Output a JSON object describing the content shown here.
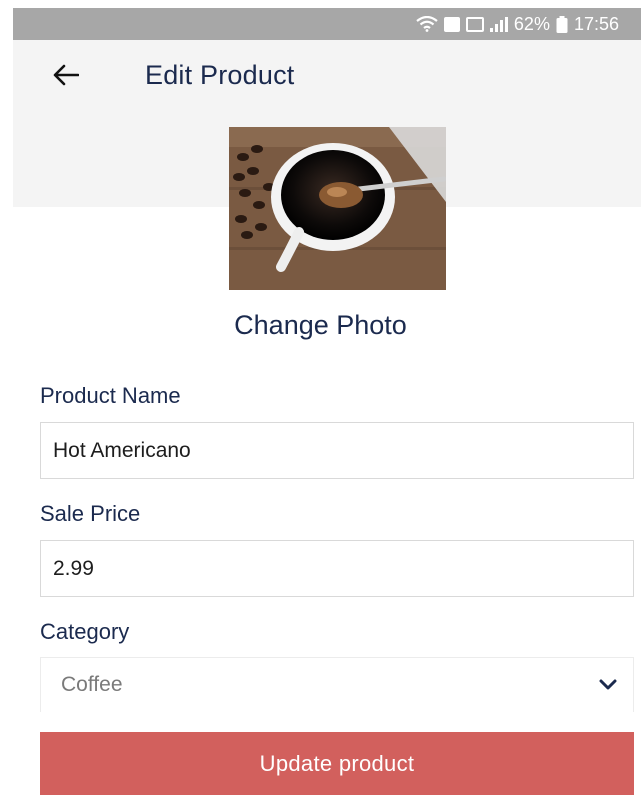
{
  "status_bar": {
    "battery_percent": "62%",
    "time": "17:56",
    "icons": [
      "wifi-icon",
      "sim-icon",
      "signal-box-icon",
      "signal-bars-icon",
      "battery-icon"
    ]
  },
  "header": {
    "title": "Edit Product",
    "back_icon": "arrow-left-icon"
  },
  "photo": {
    "change_label": "Change Photo"
  },
  "form": {
    "product_name": {
      "label": "Product Name",
      "value": "Hot Americano"
    },
    "sale_price": {
      "label": "Sale Price",
      "value": "2.99"
    },
    "category": {
      "label": "Category",
      "selected": "Coffee",
      "icon": "chevron-down-icon"
    }
  },
  "actions": {
    "update_label": "Update product"
  },
  "colors": {
    "primary_text": "#1b2a4e",
    "button_bg": "#d2605d",
    "status_bar_bg": "#a7a7a7",
    "header_bg": "#f4f4f4"
  }
}
